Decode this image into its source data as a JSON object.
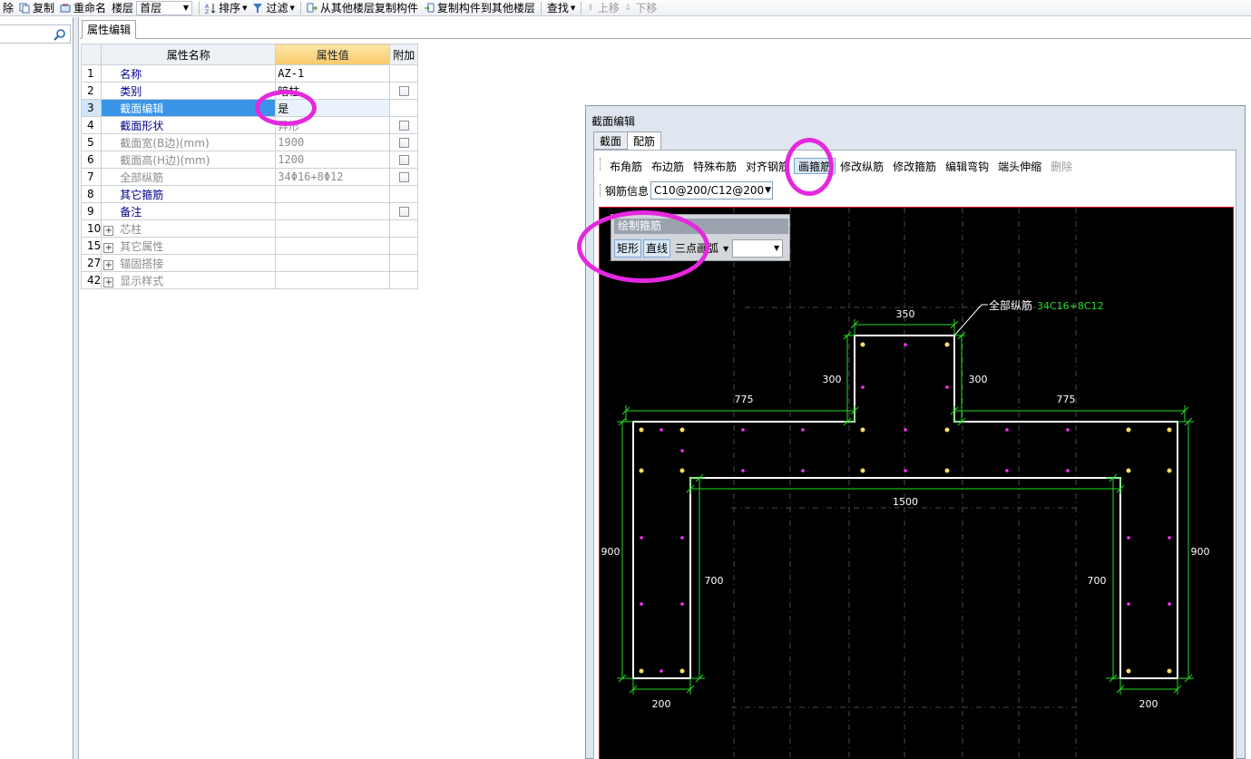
{
  "toolbar": {
    "delete_fragment": "除",
    "copy": "复制",
    "rename": "重命名",
    "floor_label": "楼层",
    "floor_value": "首层",
    "sort": "排序",
    "filter": "过滤",
    "copy_from_floors": "从其他楼层复制构件",
    "copy_to_floors": "复制构件到其他楼层",
    "find": "查找",
    "move_up": "上移",
    "move_down": "下移"
  },
  "property_panel": {
    "tab": "属性编辑",
    "headers": {
      "name": "属性名称",
      "value": "属性值",
      "extra": "附加"
    },
    "rows": [
      {
        "num": "1",
        "name": "名称",
        "value": "AZ-1"
      },
      {
        "num": "2",
        "name": "类别",
        "value": "暗柱"
      },
      {
        "num": "3",
        "name": "截面编辑",
        "value": "是"
      },
      {
        "num": "4",
        "name": "截面形状",
        "value": "异形"
      },
      {
        "num": "5",
        "name": "截面宽(B边)(mm)",
        "value": "1900"
      },
      {
        "num": "6",
        "name": "截面高(H边)(mm)",
        "value": "1200"
      },
      {
        "num": "7",
        "name": "全部纵筋",
        "value": "34Φ16+8Φ12"
      },
      {
        "num": "8",
        "name": "其它箍筋",
        "value": ""
      },
      {
        "num": "9",
        "name": "备注",
        "value": ""
      },
      {
        "num": "10",
        "name": "芯柱",
        "value": ""
      },
      {
        "num": "15",
        "name": "其它属性",
        "value": ""
      },
      {
        "num": "27",
        "name": "锚固搭接",
        "value": ""
      },
      {
        "num": "42",
        "name": "显示样式",
        "value": ""
      }
    ]
  },
  "section_editor": {
    "title": "截面编辑",
    "tabs": [
      "截面",
      "配筋"
    ],
    "tools": [
      "布角筋",
      "布边筋",
      "特殊布筋",
      "对齐钢筋",
      "画箍筋",
      "修改纵筋",
      "修改箍筋",
      "编辑弯钩",
      "端头伸缩",
      "删除"
    ],
    "rebar_info_label": "钢筋信息",
    "rebar_info_value": "C10@200/C12@200",
    "palette": {
      "title": "绘制箍筋",
      "buttons": [
        "矩形",
        "直线",
        "三点画弧"
      ]
    },
    "drawing": {
      "rebar_note_label": "全部纵筋",
      "rebar_note_value": "34C16+8C12",
      "dims": {
        "top_width": "350",
        "top_height_left": "300",
        "top_height_right": "300",
        "flange_left": "775",
        "flange_right": "775",
        "inner_width": "1500",
        "leg_height_left": "900",
        "leg_height_right": "900",
        "inner_leg_left": "700",
        "inner_leg_right": "700",
        "leg_width_left": "200",
        "leg_width_right": "200"
      }
    }
  },
  "colors": {
    "accent_highlight": "#e528e0",
    "selection_blue": "#3a95e8",
    "dim_green": "#22dd22",
    "rebar_yellow": "#ffe060",
    "rebar_magenta": "#ff33ff",
    "canvas_bg": "#000000"
  }
}
